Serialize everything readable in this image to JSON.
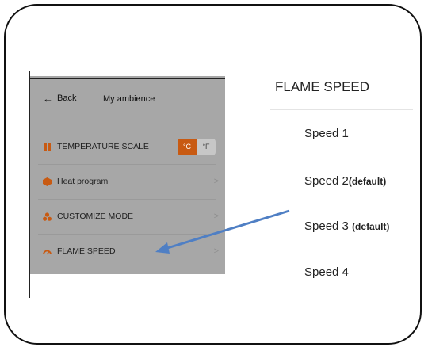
{
  "app": {
    "back_label": "Back",
    "title": "My ambience"
  },
  "menu": {
    "temperature_scale": {
      "label": "TEMPERATURE SCALE",
      "celsius": "°C",
      "fahrenheit": "°F",
      "selected": "°C"
    },
    "heat_program": {
      "label": "Heat program"
    },
    "customize_mode": {
      "label": "CUSTOMIZE MODE"
    },
    "flame_speed": {
      "label": "FLAME SPEED"
    },
    "chevron": ">"
  },
  "panel": {
    "title": "FLAME SPEED",
    "speeds": [
      {
        "label": "Speed 1",
        "note": ""
      },
      {
        "label": "Speed 2",
        "note": "(default)"
      },
      {
        "label": "Speed 3",
        "note": "(default)"
      },
      {
        "label": "Speed 4",
        "note": ""
      }
    ]
  },
  "colors": {
    "accent_orange": "#c85a12",
    "arrow_blue": "#4f7fc4",
    "phone_bg": "#a7a7a7"
  }
}
